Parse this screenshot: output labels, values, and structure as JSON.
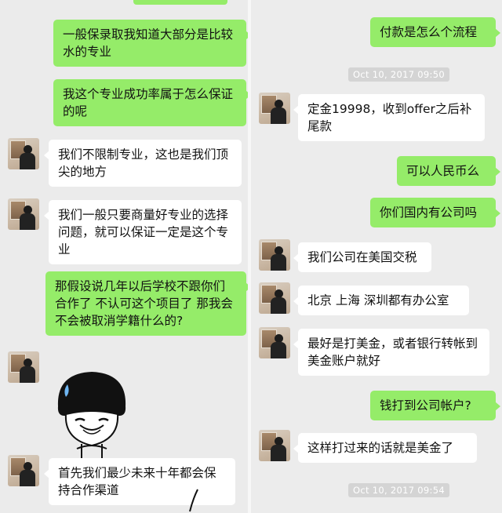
{
  "left_chat": {
    "messages": [
      {
        "text": "一般保录取我知道大部分是比较水的专业"
      },
      {
        "text": "我这个专业成功率属于怎么保证的呢"
      },
      {
        "text": "我们不限制专业，这也是我们顶尖的地方"
      },
      {
        "text": "我们一般只要商量好专业的选择问题，就可以保证一定是这个专业"
      },
      {
        "text": "那假设说几年以后学校不跟你们合作了 不认可这个项目了 那我会不会被取消学籍什么的?"
      },
      {
        "text": "首先我们最少未来十年都会保持合作渠道"
      }
    ],
    "sticker_icon": "crying-mushroom-head-meme"
  },
  "right_chat": {
    "messages": [
      {
        "text": "付款是怎么个流程"
      },
      {
        "text": "定金19998，收到offer之后补尾款"
      },
      {
        "text": "可以人民币么"
      },
      {
        "text": "你们国内有公司吗"
      },
      {
        "text": "我们公司在美国交税"
      },
      {
        "text": "北京 上海 深圳都有办公室"
      },
      {
        "text": "最好是打美金，或者银行转帐到美金账户就好"
      },
      {
        "text": "钱打到公司帐户?"
      },
      {
        "text": "这样打过来的话就是美金了"
      }
    ],
    "timestamps": [
      "Oct 10, 2017 09:50",
      "Oct 10, 2017 09:54"
    ]
  },
  "colors": {
    "sent_bubble": "#95ec69",
    "received_bubble": "#ffffff",
    "chat_background": "#ebebeb",
    "timestamp_bg": "#d4d4d4"
  }
}
